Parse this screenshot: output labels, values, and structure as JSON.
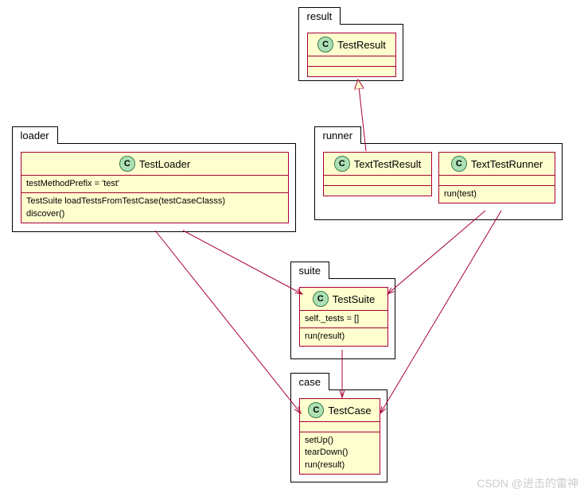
{
  "packages": {
    "result": {
      "label": "result"
    },
    "loader": {
      "label": "loader"
    },
    "runner": {
      "label": "runner"
    },
    "suite": {
      "label": "suite"
    },
    "case": {
      "label": "case"
    }
  },
  "classes": {
    "TestResult": {
      "icon": "C",
      "name": "TestResult",
      "sections": []
    },
    "TestLoader": {
      "icon": "C",
      "name": "TestLoader",
      "attrs": "testMethodPrefix = 'test'",
      "method1": "TestSuite loadTestsFromTestCase(testCaseClasss)",
      "method2": "discover()"
    },
    "TextTestResult": {
      "icon": "C",
      "name": "TextTestResult",
      "sections": []
    },
    "TextTestRunner": {
      "icon": "C",
      "name": "TextTestRunner",
      "method1": "run(test)"
    },
    "TestSuite": {
      "icon": "C",
      "name": "TestSuite",
      "attrs": "self._tests = []",
      "method1": "run(result)"
    },
    "TestCase": {
      "icon": "C",
      "name": "TestCase",
      "method1": "setUp()",
      "method2": "tearDown()",
      "method3": "run(result)"
    }
  },
  "watermark": "CSDN @进击的雷神"
}
